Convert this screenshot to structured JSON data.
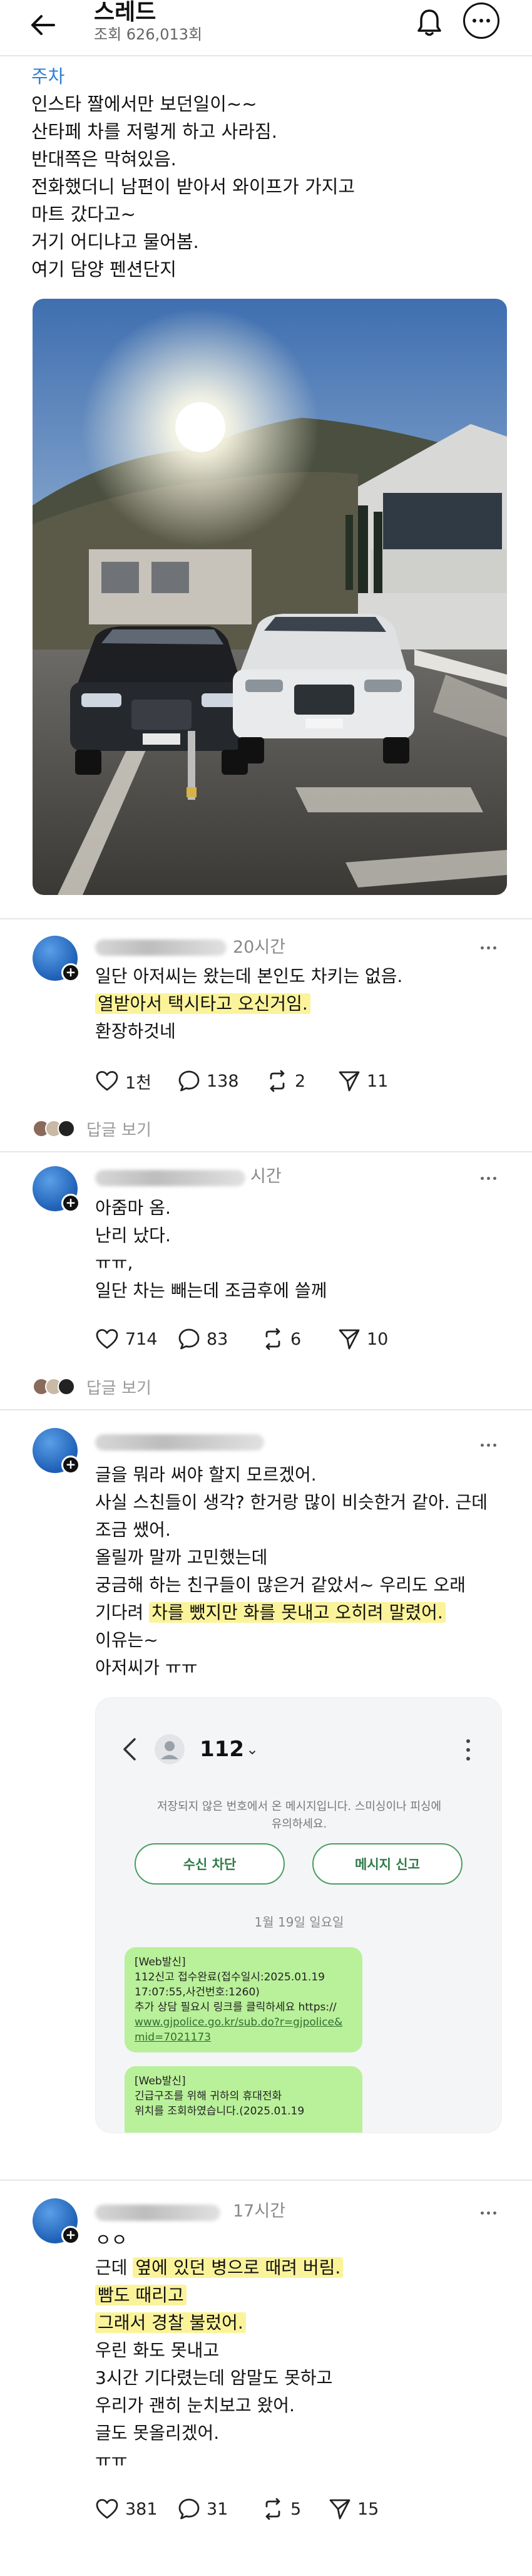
{
  "header": {
    "title": "스레드",
    "views": "조회 626,013회"
  },
  "post": {
    "tag": "주차",
    "lines": [
      "인스타 짤에서만 보던일이~~",
      "산타페 차를 저렇게 하고 사라짐.",
      "반대쪽은 막혀있음.",
      "전화했더니 남편이 받아서 와이프가 가지고",
      "마트 갔다고~",
      "거기 어디냐고 물어봄.",
      "여기 담양 펜션단지"
    ],
    "photo_desc_icon": "parked-cars-photo"
  },
  "comments": [
    {
      "time": "20시간",
      "lines": [
        {
          "text": "일단 아저씨는 왔는데 본인도 차키는 없음.",
          "hl": false
        },
        {
          "text": "열받아서 택시타고 오신거임.",
          "hl": true
        },
        {
          "text": "환장하것네",
          "hl": false
        }
      ],
      "likes": "1천",
      "replies": "138",
      "reposts": "2",
      "shares": "11",
      "reply_link": "답글 보기"
    },
    {
      "time": "시간",
      "lines": [
        {
          "text": "아줌마 옴.",
          "hl": false
        },
        {
          "text": "난리 났다.",
          "hl": false
        },
        {
          "text": "ㅠㅠ,",
          "hl": false
        },
        {
          "text": "일단 차는 빼는데 조금후에 쓸께",
          "hl": false
        }
      ],
      "likes": "714",
      "replies": "83",
      "reposts": "6",
      "shares": "10",
      "reply_link": "답글 보기"
    },
    {
      "time": "",
      "lines": [
        {
          "text": "글을 뭐라 써야 할지 모르겠어.",
          "hl": false
        },
        {
          "text": "사실 스친들이 생각? 한거랑 많이 비슷한거 같아. 근데",
          "hl": false
        },
        {
          "text": "조금 쌨어.",
          "hl": false
        },
        {
          "text": "올릴까 말까 고민했는데",
          "hl": false
        },
        {
          "text": "궁금해 하는 친구들이 많은거 같았서~ 우리도 오래",
          "hl": false
        },
        {
          "pre": "기다려 ",
          "text": "차를 뺐지만 화를 못내고 오히려 말렸어.",
          "hl": true
        },
        {
          "text": "이유는~",
          "hl": false
        },
        {
          "text": "아저씨가 ㅠㅠ",
          "hl": false
        }
      ],
      "embed": {
        "number": "112",
        "notice_1": "저장되지 않은 번호에서 온 메시지입니다. 스미싱이나 피싱에",
        "notice_2": "유의하세요.",
        "block_button": "수신 차단",
        "report_button": "메시지 신고",
        "date": "1월 19일 일요일",
        "msg1": {
          "l1": "[Web발신]",
          "l2": "112신고 접수완료(접수일시:2025.01.19",
          "l3": "17:07:55,사건번호:1260)",
          "l4": "추가 상담 필요시 링크를 클릭하세요 https://",
          "l5": "www.gjpolice.go.kr/sub.do?r=gjpolice&",
          "l6": "mid=7021173"
        },
        "msg2": {
          "l1": "[Web발신]",
          "l2": "긴급구조를 위해 귀하의 휴대전화",
          "l3": "위치를 조회하였습니다.(2025.01.19"
        }
      }
    },
    {
      "time": "17시간",
      "lines": [
        {
          "text": "ㅇㅇ",
          "hl": false
        },
        {
          "pre": "근데 ",
          "text": "옆에 있던 병으로 때려 버림.",
          "hl": true
        },
        {
          "text": "빰도 때리고",
          "hl": true
        },
        {
          "text": "그래서 경찰 불렀어.",
          "hl": true
        },
        {
          "text": "우린 화도 못내고",
          "hl": false
        },
        {
          "text": "3시간 기다렸는데 암말도 못하고",
          "hl": false
        },
        {
          "text": "우리가 괜히 눈치보고 왔어.",
          "hl": false
        },
        {
          "text": "글도 못올리겠어.",
          "hl": false
        },
        {
          "text": "ㅠㅠ",
          "hl": false
        }
      ],
      "likes": "381",
      "replies": "31",
      "reposts": "5",
      "shares": "15"
    }
  ],
  "colors": {
    "tag": "#2d7fd3",
    "highlight": "#fbf39a",
    "bubble": "#b9f09a",
    "accent_green": "#2d7a47"
  }
}
